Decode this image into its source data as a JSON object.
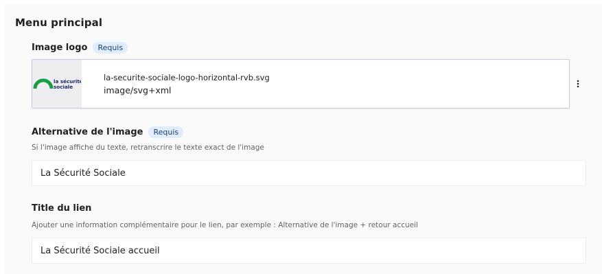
{
  "section": {
    "title": "Menu principal"
  },
  "fields": {
    "logo": {
      "label": "Image logo",
      "badge": "Requis",
      "asset": {
        "filename": "la-securite-sociale-logo-horizontal-rvb.svg",
        "mime": "image/svg+xml",
        "thumb_text_line1": "la sécurité",
        "thumb_text_line2": "sociale"
      }
    },
    "alt": {
      "label": "Alternative de l'image",
      "badge": "Requis",
      "helper": "Si l'image affiche du texte, retranscrire le texte exact de l'image",
      "value": "La Sécurité Sociale"
    },
    "link_title": {
      "label": "Title du lien",
      "helper": "Ajouter une information complémentaire pour le lien, par exemple : Alternative de l'image + retour accueil",
      "value": "La Sécurité Sociale accueil"
    }
  },
  "colors": {
    "badge_bg": "#e0eefc",
    "badge_text": "#1e3d7b",
    "logo_arc": "#14a042",
    "logo_text": "#1a2a6c"
  },
  "icons": {
    "asset_menu": "kebab-vertical-icon"
  }
}
